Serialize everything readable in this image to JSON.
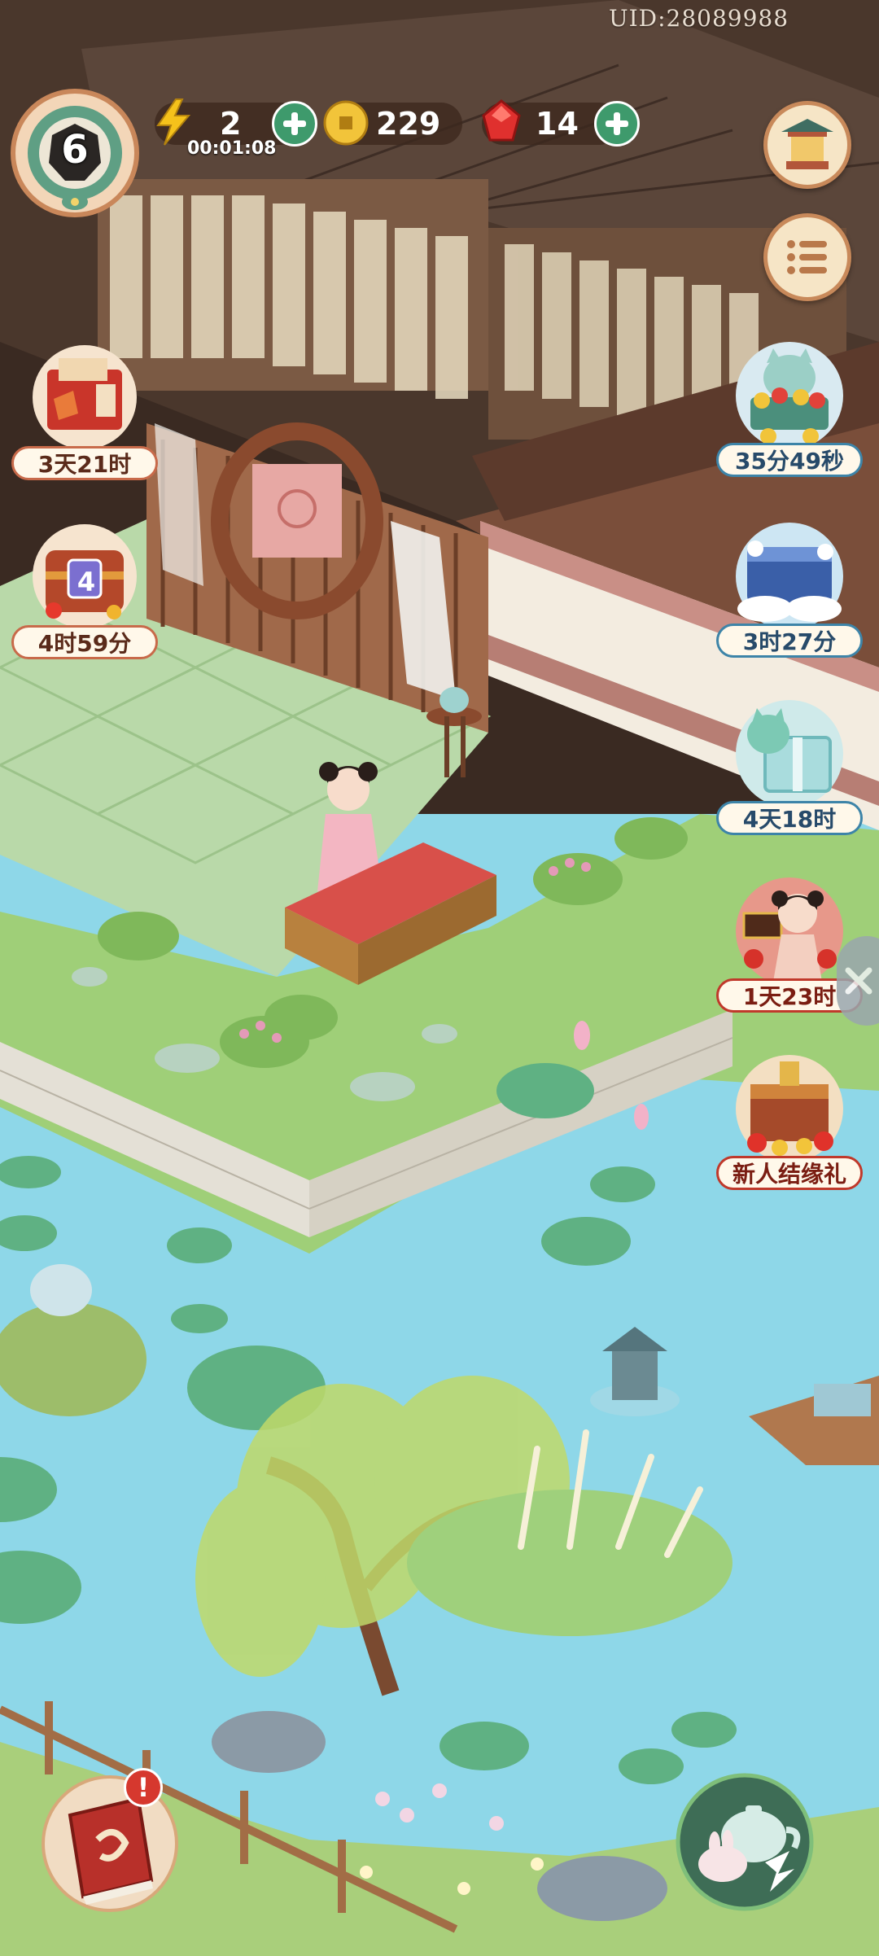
{
  "hud": {
    "uid": "UID:28089988",
    "level": "6",
    "energy": {
      "value": "2",
      "regen_timer": "00:01:08"
    },
    "coins": {
      "value": "229"
    },
    "gems": {
      "value": "14"
    },
    "plus_symbol": "+",
    "colors": {
      "pill": "#3c281e",
      "plus": "#3e9a6c",
      "accent": "#c8895a"
    }
  },
  "left_events": [
    {
      "icon": "red-gift-package-icon",
      "timer": "3天21时"
    },
    {
      "icon": "treasure-chest-level-4-icon",
      "chest_level": "4",
      "timer": "4时59分"
    }
  ],
  "right_events": [
    {
      "icon": "cat-coin-cart-icon",
      "timer": "35分49秒"
    },
    {
      "icon": "blue-snow-chest-icon",
      "timer": "3时27分"
    },
    {
      "icon": "jade-cat-giftbox-icon",
      "timer": "4天18时"
    },
    {
      "icon": "girl-character-event-icon",
      "timer": "1天23时"
    },
    {
      "icon": "newbie-chest-icon",
      "timer": "新人结缘礼"
    }
  ],
  "bottom": {
    "left_button_icon": "red-book-icon",
    "notification": "!",
    "right_button_icon": "teapot-rabbit-icon"
  }
}
